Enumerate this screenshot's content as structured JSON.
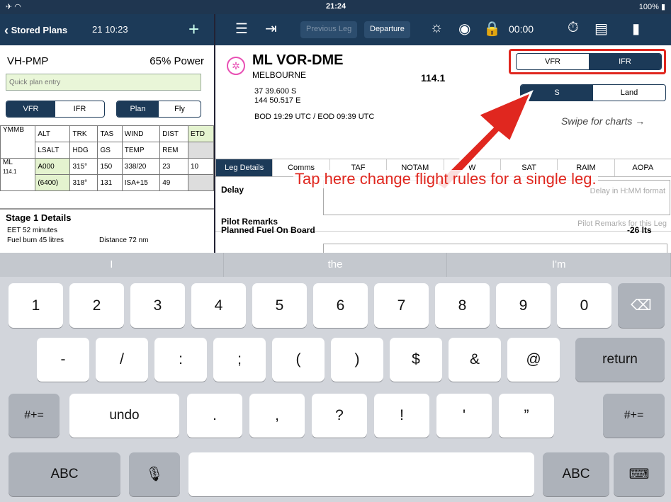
{
  "status": {
    "time": "21:24",
    "battery": "100%"
  },
  "left_nav": {
    "back_label": "Stored Plans",
    "timestamp": "21 10:23",
    "add_label": "+"
  },
  "right_nav": {
    "prev_leg_label": "Previous Leg",
    "departure_label": "Departure",
    "timer": "00:00"
  },
  "left_panel": {
    "aircraft": "VH-PMP",
    "power": "65% Power",
    "quick_entry_placeholder": "Quick plan entry",
    "vfr_label": "VFR",
    "ifr_label": "IFR",
    "plan_label": "Plan",
    "fly_label": "Fly",
    "grid": {
      "r1": [
        "YMMB",
        "ALT",
        "TRK",
        "TAS",
        "WIND",
        "DIST",
        "ETD"
      ],
      "r2": [
        "LSALT",
        "HDG",
        "GS",
        "TEMP",
        "REM"
      ],
      "r3": [
        "ML",
        "A000",
        "315°",
        "150",
        "338/20",
        "23",
        "10"
      ],
      "r3_sub": "114.1",
      "r4": [
        "(6400)",
        "318°",
        "131",
        "ISA+15",
        "49"
      ]
    },
    "stage_title": "Stage 1 Details",
    "eet": "EET 52 minutes",
    "fuel_burn": "Fuel burn 45 litres",
    "distance": "Distance 72 nm"
  },
  "right_panel": {
    "wp_name": "ML VOR-DME",
    "wp_city": "MELBOURNE",
    "freq": "114.1",
    "lat": "37 39.600 S",
    "lon": "144 50.517 E",
    "bod_eod": "BOD 19:29 UTC / EOD 09:39 UTC",
    "vfr_label": "VFR",
    "ifr_label": "IFR",
    "sea_label": "S",
    "land_label": "Land",
    "swipe_hint": "Swipe for charts →",
    "tabs": [
      "Leg Details",
      "Comms",
      "TAF",
      "NOTAM",
      "W",
      "SAT",
      "RAIM",
      "AOPA"
    ],
    "delay_label": "Delay",
    "delay_placeholder": "Delay in H:MM format",
    "pilot_remarks_label": "Pilot Remarks",
    "pilot_remarks_placeholder": "Pilot Remarks for this Leg",
    "planned_fuel_label": "Planned Fuel On Board",
    "planned_fuel_value": "-26 lts"
  },
  "annotation": {
    "text": "Tap here change flight rules for a single leg.",
    "color": "#e0271f"
  },
  "suggestions": [
    "I",
    "the",
    "I'm"
  ],
  "keyboard": {
    "row1": [
      "1",
      "2",
      "3",
      "4",
      "5",
      "6",
      "7",
      "8",
      "9",
      "0"
    ],
    "row2": [
      "-",
      "/",
      ":",
      ";",
      "(",
      ")",
      "$",
      "&",
      "@"
    ],
    "return_label": "return",
    "symbols_label": "#+=",
    "undo_label": "undo",
    "row3": [
      ".",
      ",",
      "?",
      "!",
      "'",
      "”"
    ],
    "abc_label": "ABC"
  }
}
